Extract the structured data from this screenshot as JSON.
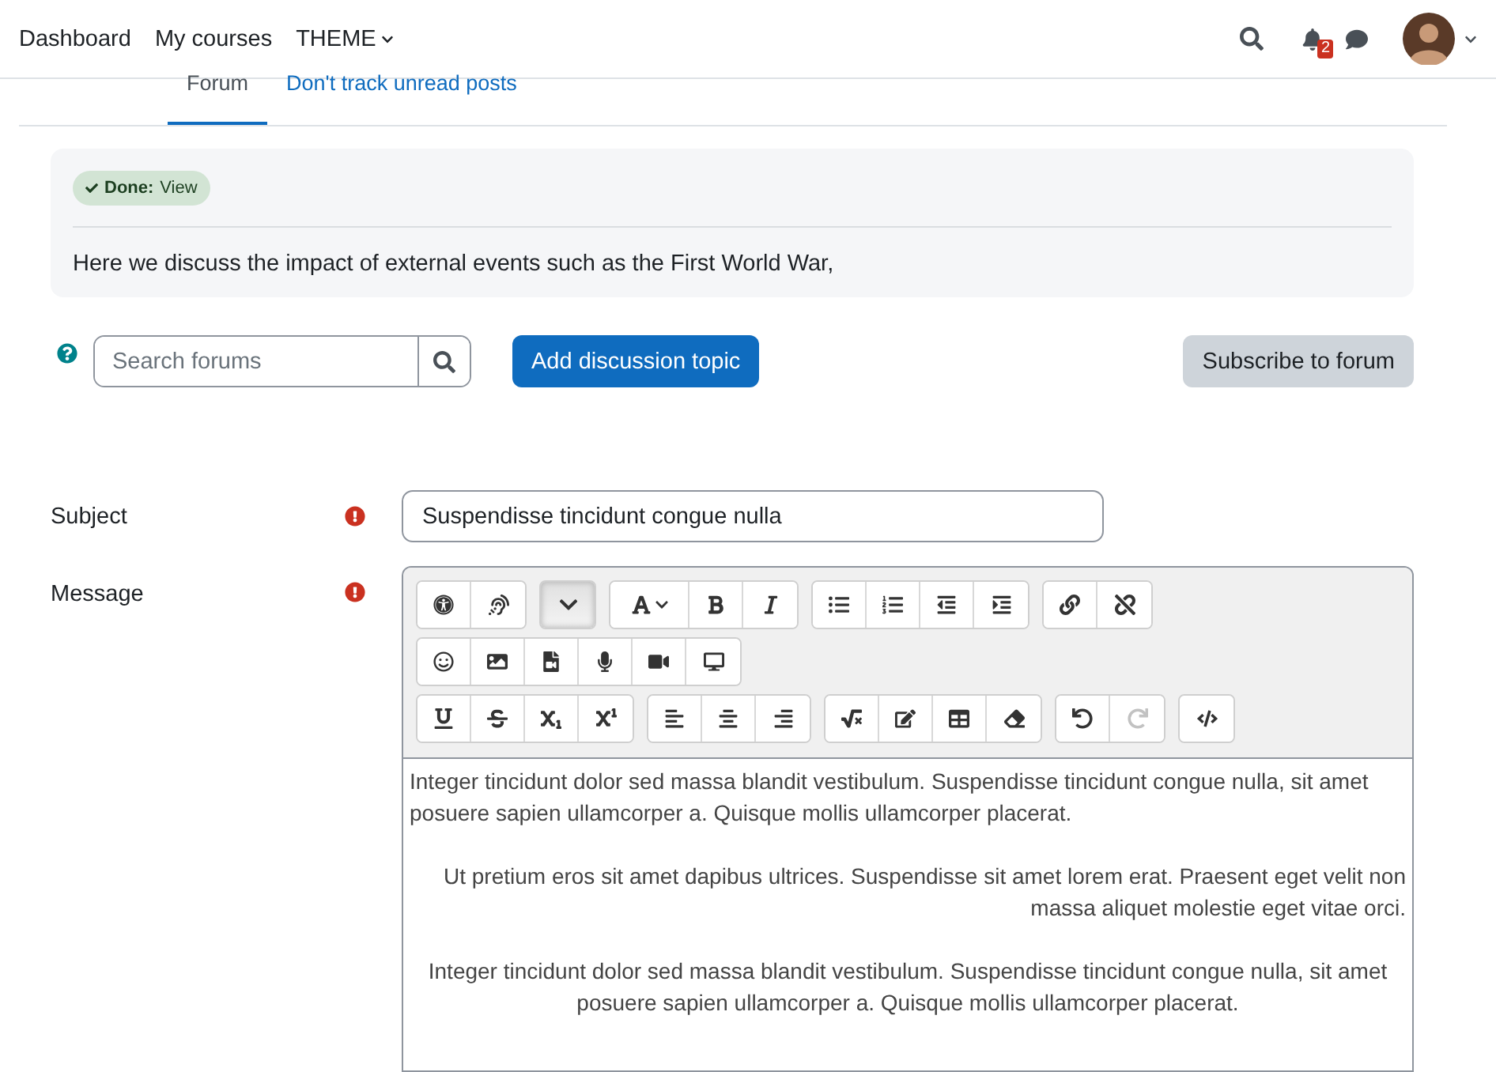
{
  "navbar": {
    "links": [
      {
        "label": "Dashboard"
      },
      {
        "label": "My courses"
      },
      {
        "label": "THEME",
        "kind": "dropdown"
      }
    ],
    "notification_count": "2"
  },
  "tabs": [
    {
      "label": "Forum",
      "selected": true
    },
    {
      "label": "Don't track unread posts",
      "selected": false
    }
  ],
  "activity": {
    "completion": {
      "status": "Done:",
      "label": "View",
      "done": true
    },
    "description": "Here we discuss the impact of external events such as the First World War,"
  },
  "search": {
    "placeholder": "Search forums"
  },
  "buttons": {
    "add": "Add discussion topic",
    "subscribe": "Subscribe to forum"
  },
  "form": {
    "subject": {
      "label": "Subject",
      "required": true,
      "value": "Suspendisse tincidunt congue nulla"
    },
    "message": {
      "label": "Message",
      "required": true,
      "toolbar": [
        [
          [
            {
              "kind": "accessibility"
            },
            {
              "kind": "hearing"
            }
          ],
          [
            {
              "kind": "toggle",
              "pressed": true
            }
          ],
          [
            {
              "kind": "font"
            },
            {
              "kind": "bold"
            },
            {
              "kind": "italic"
            }
          ],
          [
            {
              "kind": "bullets"
            },
            {
              "kind": "numbers"
            },
            {
              "kind": "outdent"
            },
            {
              "kind": "indent"
            }
          ],
          [
            {
              "kind": "link"
            },
            {
              "kind": "unlink"
            }
          ]
        ],
        [
          [
            {
              "kind": "emoji"
            },
            {
              "kind": "image"
            },
            {
              "kind": "file"
            },
            {
              "kind": "mic"
            },
            {
              "kind": "video"
            },
            {
              "kind": "devices"
            }
          ]
        ],
        [
          [
            {
              "kind": "underline"
            },
            {
              "kind": "strike"
            },
            {
              "kind": "subscript"
            },
            {
              "kind": "superscript"
            }
          ],
          [
            {
              "kind": "left"
            },
            {
              "kind": "center"
            },
            {
              "kind": "right"
            }
          ],
          [
            {
              "kind": "equation"
            },
            {
              "kind": "edit"
            },
            {
              "kind": "table"
            },
            {
              "kind": "eraser"
            }
          ],
          [
            {
              "kind": "undo",
              "disabled": false
            },
            {
              "kind": "redo",
              "disabled": true
            }
          ],
          [
            {
              "kind": "code"
            }
          ]
        ]
      ],
      "paragraphs": [
        {
          "kind": "left",
          "text": "Integer tincidunt dolor sed massa blandit vestibulum. Suspendisse tincidunt congue nulla, sit amet posuere sapien ullamcorper a. Quisque mollis ullamcorper placerat."
        },
        {
          "kind": "right",
          "text": "Ut pretium eros sit amet dapibus ultrices. Suspendisse sit amet lorem erat. Praesent eget velit non massa aliquet molestie eget vitae orci."
        },
        {
          "kind": "center",
          "text": "Integer tincidunt dolor sed massa blandit vestibulum. Suspendisse tincidunt congue nulla, sit amet posuere sapien ullamcorper a. Quisque mollis ullamcorper placerat."
        }
      ]
    }
  }
}
